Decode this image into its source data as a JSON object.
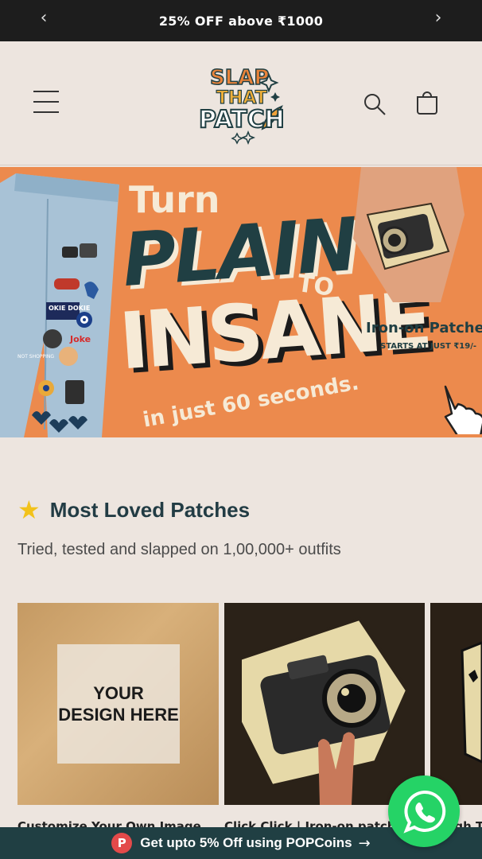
{
  "announcement": {
    "text": "25% OFF above ₹1000",
    "prev_icon": "chevron-left-icon",
    "next_icon": "chevron-right-icon"
  },
  "header": {
    "logo_lines": [
      "SLAP",
      "THAT",
      "PATCH"
    ],
    "menu_icon": "hamburger-icon",
    "search_icon": "search-icon",
    "cart_icon": "cart-icon"
  },
  "hero": {
    "line1": "Turn",
    "line2": "PLAIN",
    "line3": "TO",
    "line4": "INSANE",
    "line5": "in just 60 seconds.",
    "product_title": "Iron-on Patches",
    "product_sub": "STARTS AT JUST ₹19/-",
    "jeans_patch_texts": [
      "OKIE DOKIE",
      "Joke",
      "NOT SHOPPING"
    ]
  },
  "section": {
    "icon": "star-icon",
    "title": "Most Loved Patches",
    "subtitle": "Tried, tested and slapped on 1,00,000+ outfits"
  },
  "products": [
    {
      "image_text": "YOUR DESIGN HERE",
      "caption": "Customize Your Own Image"
    },
    {
      "image_text": "",
      "caption": "Click Click | Iron-on patch"
    },
    {
      "image_text": "",
      "caption": "Laugh Track"
    }
  ],
  "colors": {
    "announce_bg": "#1d1d1d",
    "page_bg": "#ede5df",
    "hero_bg": "#ec8a4d",
    "brand_teal": "#203f43",
    "whatsapp": "#25d366",
    "popcoin_red": "#e34a4a"
  },
  "bottom_bar": {
    "icon": "popcoins-icon",
    "icon_letter": "P",
    "text": "Get upto 5% Off using POPCoins",
    "arrow": "→"
  },
  "whatsapp": {
    "icon": "whatsapp-icon"
  }
}
